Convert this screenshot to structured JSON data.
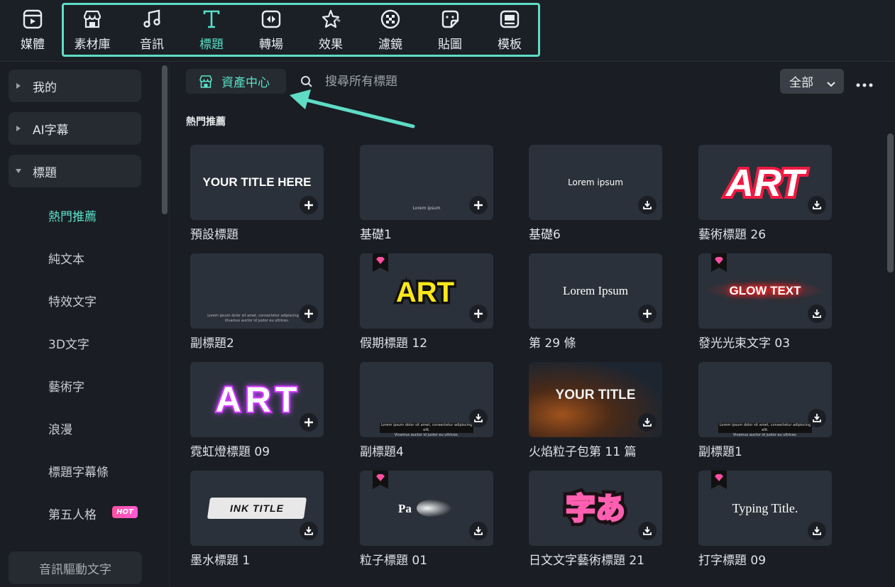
{
  "toolbar": {
    "items": [
      {
        "label": "媒體",
        "icon": "media-icon"
      },
      {
        "label": "素材庫",
        "icon": "store-icon"
      },
      {
        "label": "音訊",
        "icon": "music-note-icon"
      },
      {
        "label": "標題",
        "icon": "text-t-icon",
        "active": true
      },
      {
        "label": "轉場",
        "icon": "transition-icon"
      },
      {
        "label": "效果",
        "icon": "effects-star-icon"
      },
      {
        "label": "濾鏡",
        "icon": "filter-icon"
      },
      {
        "label": "貼圖",
        "icon": "sticker-icon"
      },
      {
        "label": "模板",
        "icon": "template-icon"
      }
    ]
  },
  "sidebar": {
    "categories": [
      {
        "label": "我的",
        "expanded": false
      },
      {
        "label": "AI字幕",
        "expanded": false
      },
      {
        "label": "標題",
        "expanded": true
      }
    ],
    "subitems": [
      {
        "label": "熱門推薦",
        "active": true
      },
      {
        "label": "純文本"
      },
      {
        "label": "特效文字"
      },
      {
        "label": "3D文字"
      },
      {
        "label": "藝術字"
      },
      {
        "label": "浪漫"
      },
      {
        "label": "標題字幕條"
      },
      {
        "label": "第五人格",
        "badge": "HOT"
      }
    ],
    "bottom_button": "音訊驅動文字"
  },
  "main": {
    "asset_center_label": "資產中心",
    "search_placeholder": "搜尋所有標題",
    "filter_value": "全部",
    "section_title": "熱門推薦",
    "thumb_texts": {
      "default_title": "YOUR TITLE HERE",
      "lorem_small": "Lorem ipsum",
      "lorem_serif": "Lorem Ipsum",
      "art": "ART",
      "glow": "GLOW TEXT",
      "fire": "YOUR TITLE",
      "ink": "INK TITLE",
      "particle": "Pa",
      "jp": "字あ",
      "typing": "Typing Title.",
      "sub_line1": "Lorem ipsum dolor sit amet, consectetur adipiscing elit.",
      "sub_line2": "Vivamus auctor id justor eu ultrices."
    },
    "cards": [
      {
        "label": "預設標題",
        "action": "add"
      },
      {
        "label": "基礎1",
        "action": "add"
      },
      {
        "label": "基礎6",
        "action": "download"
      },
      {
        "label": "藝術標題 26",
        "action": "download"
      },
      {
        "label": "副標題2",
        "action": "add"
      },
      {
        "label": "假期標題 12",
        "action": "add",
        "premium": true
      },
      {
        "label": "第 29 條",
        "action": "add"
      },
      {
        "label": "發光光束文字 03",
        "action": "download",
        "premium": true
      },
      {
        "label": "霓虹燈標題 09",
        "action": "add"
      },
      {
        "label": "副標題4",
        "action": "download"
      },
      {
        "label": "火焰粒子包第 11 篇",
        "action": "download"
      },
      {
        "label": "副標題1",
        "action": "download"
      },
      {
        "label": "墨水標題 1",
        "action": "download"
      },
      {
        "label": "粒子標題 01",
        "action": "download",
        "premium": true
      },
      {
        "label": "日文文字藝術標題 21",
        "action": "download"
      },
      {
        "label": "打字標題 09",
        "action": "download",
        "premium": true
      }
    ]
  },
  "colors": {
    "accent": "#59e0c8",
    "highlight_box": "#5fdcc6",
    "card_bg": "#2b313a",
    "hot_badge": "#ff4fa0"
  }
}
